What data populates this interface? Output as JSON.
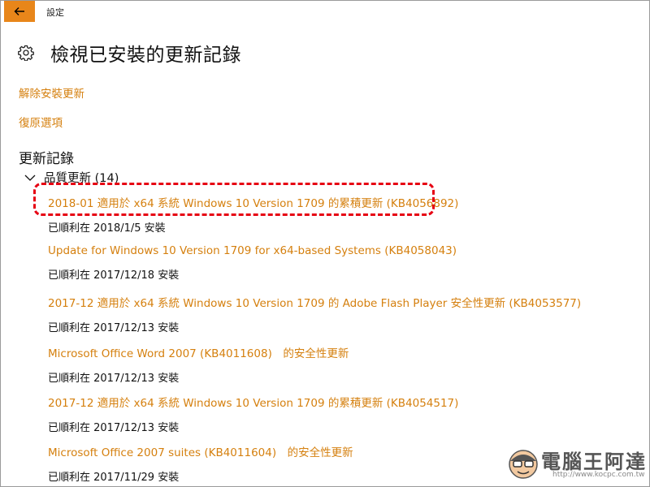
{
  "window": {
    "title": "設定"
  },
  "page": {
    "title": "檢視已安裝的更新記錄"
  },
  "links": {
    "uninstall": "解除安裝更新",
    "recovery": "復原選項"
  },
  "history": {
    "section_title": "更新記錄",
    "group_label": "品質更新 (14)",
    "updates": [
      {
        "name": "2018-01 適用於 x64 系統 Windows 10 Version 1709 的累積更新 (KB4056892)",
        "status": "已順利在 2018/1/5 安裝"
      },
      {
        "name": "Update for Windows 10 Version 1709 for x64-based Systems (KB4058043)",
        "status": "已順利在 2017/12/18 安裝"
      },
      {
        "name": "2017-12 適用於 x64 系統 Windows 10 Version 1709 的 Adobe Flash Player 安全性更新 (KB4053577)",
        "status": "已順利在 2017/12/13 安裝"
      },
      {
        "name": "Microsoft Office Word 2007 (KB4011608)　的安全性更新",
        "status": "已順利在 2017/12/13 安裝"
      },
      {
        "name": "2017-12 適用於 x64 系統 Windows 10 Version 1709 的累積更新 (KB4054517)",
        "status": "已順利在 2017/12/13 安裝"
      },
      {
        "name": "Microsoft Office 2007 suites (KB4011604)　的安全性更新",
        "status": "已順利在 2017/11/29 安裝"
      }
    ]
  },
  "watermark": {
    "text": "電腦王阿達",
    "url": "http://www.kocpc.com.tw"
  },
  "colors": {
    "accent": "#d5800f",
    "back_button": "#e8861a",
    "highlight": "#e60012"
  },
  "icons": {
    "back": "arrow-left-icon",
    "settings": "gear-icon",
    "group_toggle": "chevron-down-icon"
  }
}
